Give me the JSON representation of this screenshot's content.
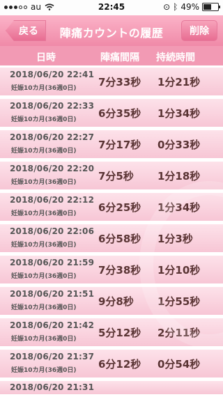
{
  "status_bar": {
    "carrier": "au",
    "time": "22:45",
    "battery": "49%",
    "battery_level": 0.49
  },
  "nav": {
    "back_label": "戻る",
    "title": "陣痛カウントの履歴",
    "delete_label": "削除"
  },
  "table": {
    "headers": {
      "time": "日時",
      "interval": "陣痛間隔",
      "duration": "持続時間"
    },
    "rows": [
      {
        "datetime": "2018/06/20 22:41",
        "pregnancy": "妊娠10カ月(36週0日)",
        "interval": "7分33秒",
        "duration": "1分21秒"
      },
      {
        "datetime": "2018/06/20 22:33",
        "pregnancy": "妊娠10カ月(36週0日)",
        "interval": "6分35秒",
        "duration": "1分34秒"
      },
      {
        "datetime": "2018/06/20 22:27",
        "pregnancy": "妊娠10カ月(36週0日)",
        "interval": "7分17秒",
        "duration": "0分33秒"
      },
      {
        "datetime": "2018/06/20 22:20",
        "pregnancy": "妊娠10カ月(36週0日)",
        "interval": "7分5秒",
        "duration": "1分18秒"
      },
      {
        "datetime": "2018/06/20 22:12",
        "pregnancy": "妊娠10カ月(36週0日)",
        "interval": "6分25秒",
        "duration": "1分34秒"
      },
      {
        "datetime": "2018/06/20 22:06",
        "pregnancy": "妊娠10カ月(36週0日)",
        "interval": "6分58秒",
        "duration": "1分3秒"
      },
      {
        "datetime": "2018/06/20 21:59",
        "pregnancy": "妊娠10カ月(36週0日)",
        "interval": "7分38秒",
        "duration": "1分10秒"
      },
      {
        "datetime": "2018/06/20 21:51",
        "pregnancy": "妊娠10カ月(36週0日)",
        "interval": "9分8秒",
        "duration": "1分55秒"
      },
      {
        "datetime": "2018/06/20 21:42",
        "pregnancy": "妊娠10カ月(36週0日)",
        "interval": "5分12秒",
        "duration": "2分11秒"
      },
      {
        "datetime": "2018/06/20 21:37",
        "pregnancy": "妊娠10カ月(36週0日)",
        "interval": "6分12秒",
        "duration": "0分54秒"
      }
    ],
    "partial_row": {
      "datetime": "2018/06/20 21:31"
    }
  },
  "colors": {
    "header_pink": "#f29ab4",
    "nav_pink": "#f08aa8",
    "row_pink": "#f7c6d5",
    "value_brown": "#5a3434"
  }
}
